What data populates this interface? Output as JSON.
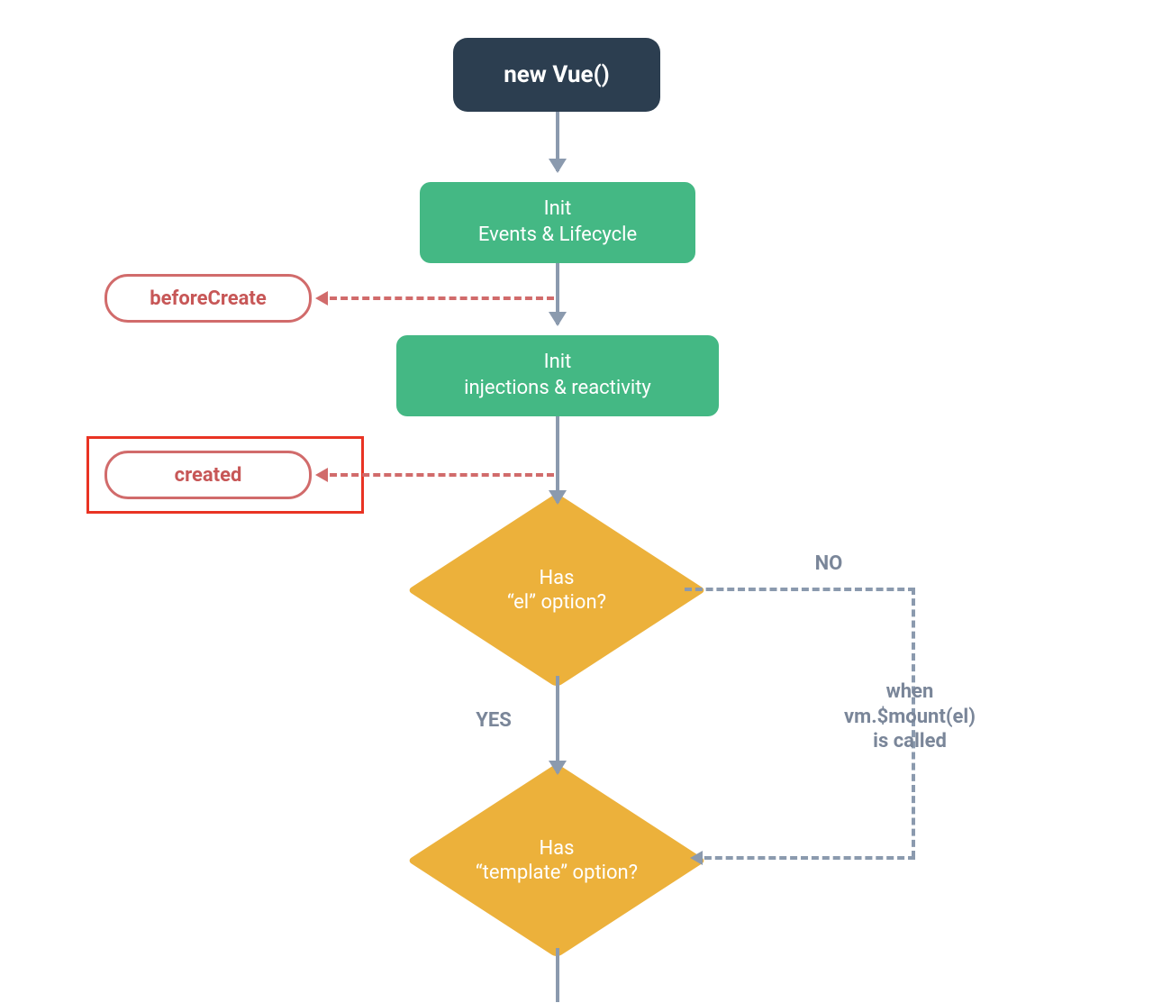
{
  "nodes": {
    "start": "new Vue()",
    "proc1_line1": "Init",
    "proc1_line2": "Events & Lifecycle",
    "proc2_line1": "Init",
    "proc2_line2": "injections & reactivity",
    "hook_beforeCreate": "beforeCreate",
    "hook_created": "created",
    "dia1_line1": "Has",
    "dia1_line2": "“el” option?",
    "dia2_line1": "Has",
    "dia2_line2": "“template” option?"
  },
  "labels": {
    "no": "NO",
    "yes": "YES",
    "when_line1": "when",
    "when_line2": "vm.$mount(el)",
    "when_line3": "is called"
  },
  "colors": {
    "start_bg": "#2c3e50",
    "process_bg": "#44b884",
    "hook_border": "#d16b6b",
    "hook_text": "#c75757",
    "diamond_bg": "#ecb13b",
    "arrow_gray": "#8b9aae",
    "highlight": "#e93323"
  }
}
